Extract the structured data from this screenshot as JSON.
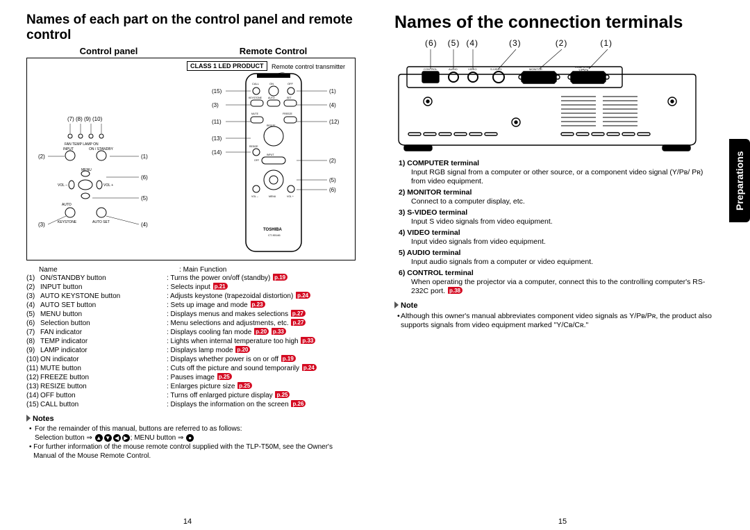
{
  "leftPage": {
    "title": "Names of each part on the control panel and remote control",
    "subheads": {
      "left": "Control panel",
      "right": "Remote Control"
    },
    "class1": "CLASS 1 LED PRODUCT",
    "remoteTrans": "Remote control transmitter",
    "controlPanel": {
      "labels": [
        "FAN",
        "TEMP",
        "LAMP",
        "ON",
        "INPUT",
        "ON / STANDBY",
        "MENU",
        "VOL –",
        "VOL +",
        "AUTO KEYSTONE",
        "AUTO SET"
      ],
      "callouts": [
        "(7)",
        "(8)",
        "(9)",
        "(10)",
        "(2)",
        "(1)",
        "(6)",
        "(5)",
        "(3)",
        "(4)"
      ]
    },
    "remote": {
      "brand": "TOSHIBA",
      "model": "CT-90146",
      "leftCallouts": [
        "(15)",
        "(3)",
        "(11)",
        "(13)",
        "(14)"
      ],
      "rightCallouts": [
        "(1)",
        "(4)",
        "(12)",
        "(2)",
        "(5)",
        "(6)"
      ],
      "buttons": [
        "CALL",
        "ON",
        "OFF",
        "KEYSTONE",
        "AUTO",
        "SET",
        "MUTE",
        "FREEZE",
        "RESIZE",
        "INPUT",
        "VOL –",
        "MENU",
        "VOL +"
      ]
    },
    "tableHeader": {
      "name": "Name",
      "func": "Main Function"
    },
    "functions": [
      {
        "num": "(1)",
        "name": "ON/STANDBY button",
        "desc": "Turns the power on/off (standby)",
        "refs": [
          "p.19"
        ]
      },
      {
        "num": "(2)",
        "name": "INPUT button",
        "desc": "Selects input",
        "refs": [
          "p.21"
        ]
      },
      {
        "num": "(3)",
        "name": "AUTO KEYSTONE button",
        "desc": "Adjusts keystone (trapezoidal distortion)",
        "refs": [
          "p.24"
        ]
      },
      {
        "num": "(4)",
        "name": "AUTO SET button",
        "desc": "Sets up image and mode",
        "refs": [
          "p.23"
        ]
      },
      {
        "num": "(5)",
        "name": "MENU button",
        "desc": "Displays menus and makes selections",
        "refs": [
          "p.27"
        ]
      },
      {
        "num": "(6)",
        "name": "Selection button",
        "desc": "Menu selections and adjustments, etc.",
        "refs": [
          "p.27"
        ]
      },
      {
        "num": "(7)",
        "name": "FAN indicator",
        "desc": "Displays cooling fan mode",
        "refs": [
          "p.20",
          "p.33"
        ]
      },
      {
        "num": "(8)",
        "name": "TEMP indicator",
        "desc": "Lights when internal temperature too high",
        "refs": [
          "p.33"
        ]
      },
      {
        "num": "(9)",
        "name": "LAMP indicator",
        "desc": "Displays lamp mode",
        "refs": [
          "p.20"
        ]
      },
      {
        "num": "(10)",
        "name": "ON indicator",
        "desc": "Displays whether power is on or off",
        "refs": [
          "p.19"
        ]
      },
      {
        "num": "(11)",
        "name": "MUTE button",
        "desc": "Cuts off the picture and sound temporarily",
        "refs": [
          "p.24"
        ]
      },
      {
        "num": "(12)",
        "name": "FREEZE button",
        "desc": "Pauses image",
        "refs": [
          "p.25"
        ]
      },
      {
        "num": "(13)",
        "name": "RESIZE button",
        "desc": "Enlarges picture size",
        "refs": [
          "p.25"
        ]
      },
      {
        "num": "(14)",
        "name": "OFF button",
        "desc": "Turns off enlarged picture display",
        "refs": [
          "p.25"
        ]
      },
      {
        "num": "(15)",
        "name": "CALL button",
        "desc": "Displays the information on the screen",
        "refs": [
          "p.26"
        ]
      }
    ],
    "notesHeading": "Notes",
    "notes": [
      "For the remainder of this manual, buttons are referred to as follows:",
      "For further information of the mouse remote control supplied with the TLP-T50M, see the Owner's Manual of the Mouse Remote Control."
    ],
    "noteLine2Pre": "Selection button ⇒ ",
    "noteLine2Mid": "; MENU button ⇒ ",
    "pageNum": "14"
  },
  "rightPage": {
    "title": "Names of the connection terminals",
    "callouts": [
      "(6)",
      "(5)",
      "(4)",
      "(3)",
      "(2)",
      "(1)"
    ],
    "terminalLabels": [
      "CONTROL",
      "AUDIO",
      "VIDEO",
      "S-VIDEO",
      "MONITOR",
      "COMPUTER Y/Pᴮ/Pʀ"
    ],
    "terminals": [
      {
        "head": "1) COMPUTER terminal",
        "desc": "Input RGB signal from a computer or other source, or a component video signal (Y/Pʙ/ Pʀ) from video equipment."
      },
      {
        "head": "2) MONITOR terminal",
        "desc": "Connect to a computer display, etc."
      },
      {
        "head": "3) S-VIDEO terminal",
        "desc": "Input S video signals from video equipment."
      },
      {
        "head": "4) VIDEO terminal",
        "desc": "Input video signals from video equipment."
      },
      {
        "head": "5) AUDIO terminal",
        "desc": "Input audio signals from a computer or video equipment."
      },
      {
        "head": "6) CONTROL terminal",
        "desc": "When operating the projector via a computer, connect this to the controlling computer's RS-232C port.",
        "refs": [
          "p.38"
        ]
      }
    ],
    "noteHeading": "Note",
    "note": "Although this owner's manual abbreviates component video signals as Y/Pʙ/Pʀ, the product also supports signals from video equipment marked \"Y/Cʙ/Cʀ.\"",
    "pageNum": "15",
    "sideTab": "Preparations"
  }
}
